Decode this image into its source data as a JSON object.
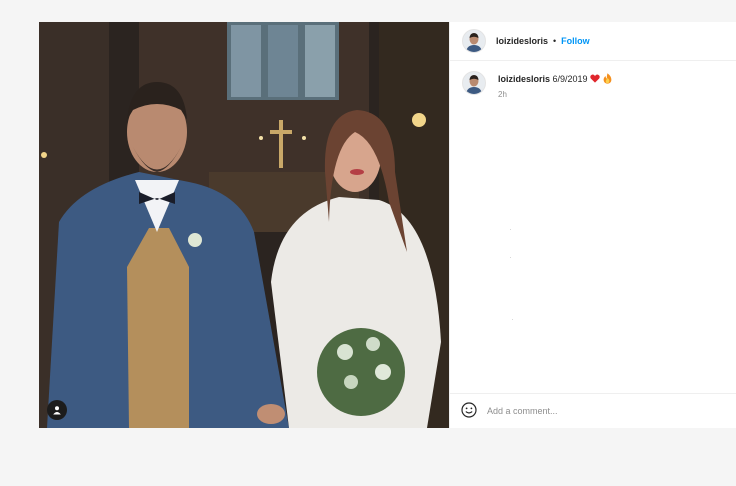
{
  "post": {
    "username": "loizidesloris",
    "follow_label": "Follow",
    "separator": "•",
    "caption": {
      "username": "loizidesloris",
      "text": "6/9/2019",
      "emojis": [
        "red-heart",
        "fire"
      ],
      "time": "2h"
    },
    "add_comment_placeholder": "Add a comment...",
    "photo_description_icon": "person-tag-icon"
  },
  "colors": {
    "accent": "#0095f6",
    "text": "#262626",
    "muted": "#8e8e8e",
    "background": "#f5f5f5"
  }
}
